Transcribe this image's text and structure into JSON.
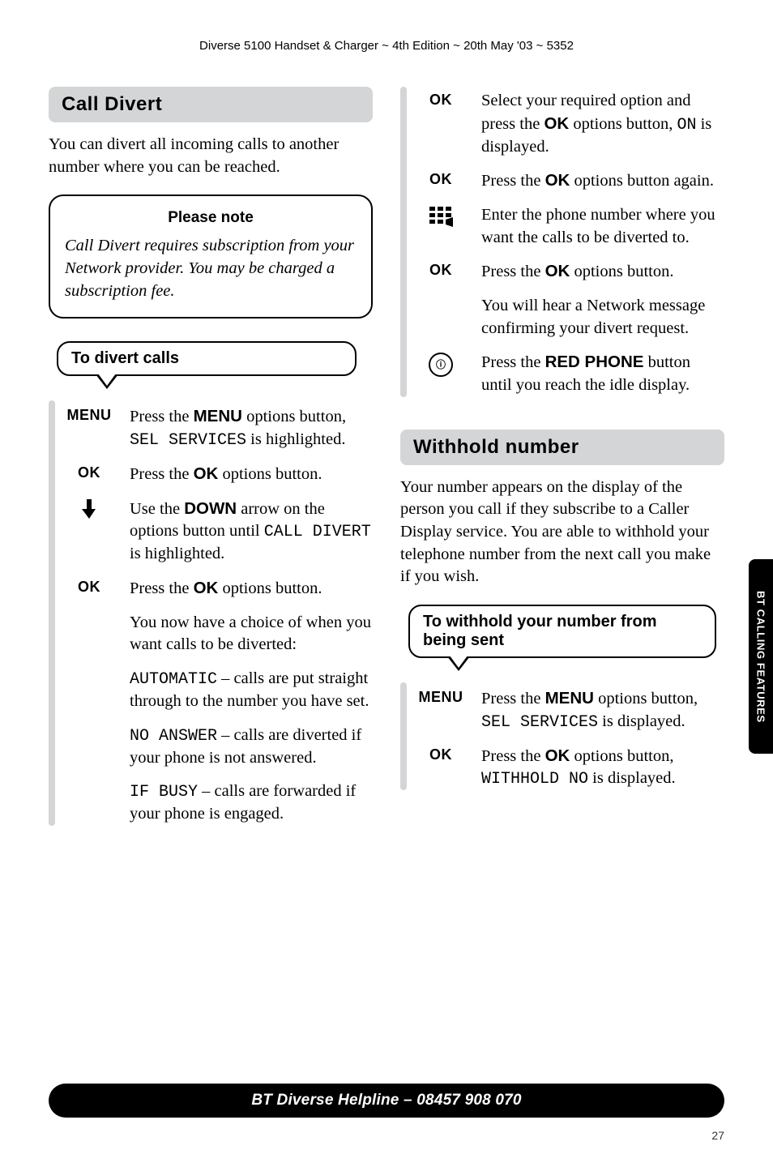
{
  "header": "Diverse 5100 Handset & Charger ~ 4th Edition ~ 20th May '03 ~ 5352",
  "side_tab": "BT CALLING FEATURES",
  "footer": "BT Diverse Helpline – 08457 908 070",
  "page_number": "27",
  "left": {
    "section1_title": "Call Divert",
    "section1_intro": "You can divert all incoming calls to another number where you can be reached.",
    "note_title": "Please note",
    "note_text": "Call Divert requires subscription from your Network provider. You may be charged a subscription fee.",
    "proc1_title": "To divert calls",
    "steps": {
      "k_menu": "MENU",
      "s_menu_a": "Press the ",
      "s_menu_b": "MENU",
      "s_menu_c": " options button, ",
      "s_menu_lcd": "SEL SERVICES",
      "s_menu_d": " is highlighted.",
      "k_ok1": "OK",
      "s_ok1_a": "Press the ",
      "s_ok1_b": "OK",
      "s_ok1_c": " options button.",
      "s_down_a": "Use the ",
      "s_down_b": "DOWN",
      "s_down_c": " arrow on the options button until ",
      "s_down_lcd": "CALL DIVERT",
      "s_down_d": " is highlighted.",
      "k_ok2": "OK",
      "s_ok2_a": "Press the ",
      "s_ok2_b": "OK",
      "s_ok2_c": " options button.",
      "s_choice": "You now have a choice of when you want calls to be diverted:",
      "opt1_lcd": "AUTOMATIC",
      "opt1_t": " – calls are put straight through to the number you have set.",
      "opt2_lcd": "NO ANSWER",
      "opt2_t": " – calls are diverted if your phone is not answered.",
      "opt3_lcd": "IF BUSY",
      "opt3_t": " – calls are forwarded if your phone is engaged."
    }
  },
  "right": {
    "k_ok3": "OK",
    "s_ok3_a": "Select your required option and press the ",
    "s_ok3_b": "OK",
    "s_ok3_c": " options button, ",
    "s_ok3_lcd": "ON",
    "s_ok3_d": " is displayed.",
    "k_ok4": "OK",
    "s_ok4_a": "Press the ",
    "s_ok4_b": "OK",
    "s_ok4_c": " options button again.",
    "s_kp": "Enter the phone number where you want the calls to be diverted to.",
    "k_ok5": "OK",
    "s_ok5_a": "Press the ",
    "s_ok5_b": "OK",
    "s_ok5_c": " options button.",
    "s_net": "You will hear a Network message confirming your divert request.",
    "s_red_a": "Press the ",
    "s_red_b": "RED PHONE",
    "s_red_c": " button until you reach the idle display.",
    "section2_title": "Withhold number",
    "section2_intro": "Your number appears on the display of the person you call if they subscribe to a Caller Display service. You are able to withhold your telephone number from the next call you make if you wish.",
    "proc2_title": "To withhold your number from being sent",
    "k_menu2": "MENU",
    "s_menu2_a": "Press the ",
    "s_menu2_b": "MENU",
    "s_menu2_c": " options button, ",
    "s_menu2_lcd": "SEL SERVICES",
    "s_menu2_d": " is displayed.",
    "k_ok6": "OK",
    "s_ok6_a": "Press the ",
    "s_ok6_b": "OK",
    "s_ok6_c": " options button, ",
    "s_ok6_lcd": "WITHHOLD NO",
    "s_ok6_d": " is displayed."
  }
}
